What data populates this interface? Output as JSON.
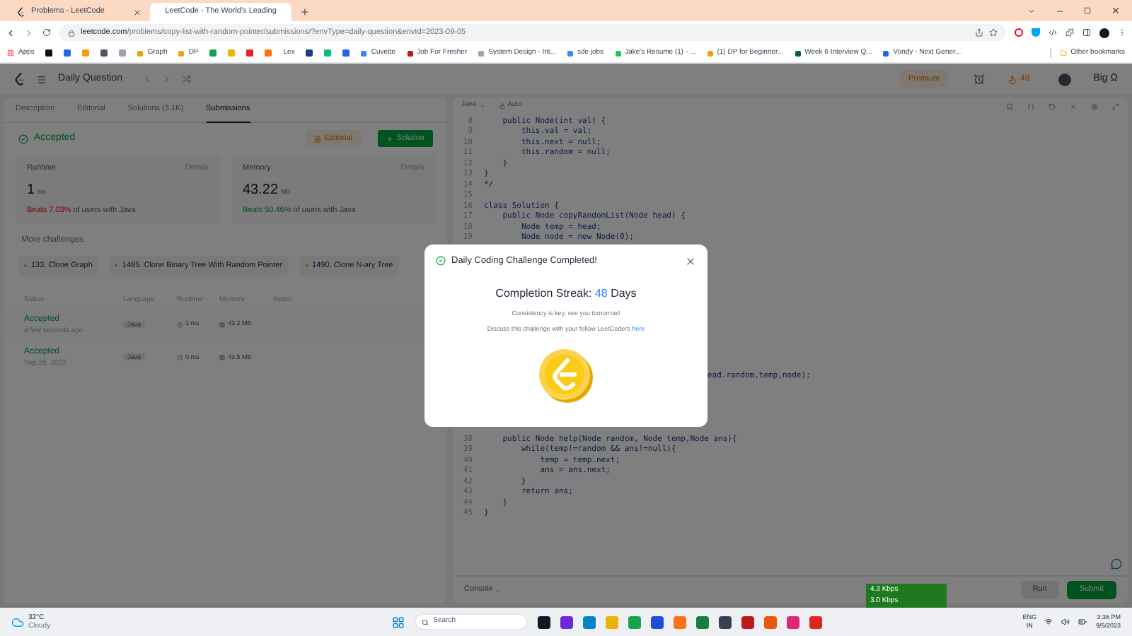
{
  "browser": {
    "tabs": [
      {
        "title": "Problems - LeetCode",
        "selected": false
      },
      {
        "title": "LeetCode - The World's Leading",
        "selected": true
      }
    ],
    "url_host": "leetcode.com",
    "url_path": "/problems/copy-list-with-random-pointer/submissions/?envType=daily-question&envId=2023-09-05",
    "bookmarks": [
      {
        "kind": "apps",
        "label": "Apps"
      },
      {
        "kind": "icon",
        "color": "#111111"
      },
      {
        "kind": "icon",
        "color": "#2563eb"
      },
      {
        "kind": "icon",
        "color": "#f59e0b"
      },
      {
        "kind": "icon",
        "color": "#4b5563"
      },
      {
        "kind": "icon",
        "color": "#9ca3af"
      },
      {
        "kind": "link",
        "label": "Graph",
        "color": "#f59e0b"
      },
      {
        "kind": "link",
        "label": "DP",
        "color": "#f59e0b"
      },
      {
        "kind": "icon",
        "color": "#16a34a"
      },
      {
        "kind": "icon",
        "color": "#eab308"
      },
      {
        "kind": "icon",
        "color": "#dc2626"
      },
      {
        "kind": "icon",
        "color": "#f97316"
      },
      {
        "kind": "link",
        "label": "Lex"
      },
      {
        "kind": "icon",
        "color": "#1e3a8a"
      },
      {
        "kind": "icon",
        "color": "#10b981"
      },
      {
        "kind": "icon",
        "color": "#2563eb"
      },
      {
        "kind": "link",
        "label": "Cuvette",
        "color": "#3b82f6"
      },
      {
        "kind": "link",
        "label": "Job For Fresher",
        "color": "#b91c1c"
      },
      {
        "kind": "link",
        "label": "System Design - Int...",
        "color": "#9ca3af"
      },
      {
        "kind": "link",
        "label": "sde jobs",
        "color": "#4285f4"
      },
      {
        "kind": "link",
        "label": "Jake's Resume (1) - ...",
        "color": "#22c55e"
      },
      {
        "kind": "link",
        "label": "(1) DP for Beginner...",
        "color": "#f59e0b"
      },
      {
        "kind": "link",
        "label": "Week 6 Interview Q...",
        "color": "#065f46"
      },
      {
        "kind": "link",
        "label": "Vondy - Next Gener...",
        "color": "#2563eb"
      }
    ],
    "other_bookmarks": "Other bookmarks"
  },
  "header": {
    "title": "Daily Question",
    "premium": "Premium",
    "streak": "48",
    "user": "Big Ω"
  },
  "problem_tabs": [
    {
      "label": "Description",
      "selected": false
    },
    {
      "label": "Editorial",
      "selected": false
    },
    {
      "label": "Solutions (3.1K)",
      "selected": false
    },
    {
      "label": "Submissions",
      "selected": true
    }
  ],
  "result": {
    "status": "Accepted",
    "editorial_button": "Editorial",
    "solution_button": "Solution"
  },
  "stats": [
    {
      "label": "Runtime",
      "details": "Details",
      "value": "1",
      "unit": "ms",
      "beats": "Beats 7.03%",
      "beats_rest": "of users with Java",
      "kind": "slow"
    },
    {
      "label": "Memory",
      "details": "Details",
      "value": "43.22",
      "unit": "MB",
      "beats": "Beats 50.46%",
      "beats_rest": "of users with Java",
      "kind": "fast"
    }
  ],
  "more_challenges": {
    "title": "More challenges",
    "items": [
      "133. Clone Graph",
      "1485. Clone Binary Tree With Random Pointer",
      "1490. Clone N-ary Tree"
    ]
  },
  "submissions": {
    "columns": [
      "Status",
      "Language",
      "Runtime",
      "Memory",
      "Notes"
    ],
    "rows": [
      {
        "status": "Accepted",
        "time": "a few seconds ago",
        "language": "Java",
        "runtime": "1 ms",
        "memory": "43.2 MB"
      },
      {
        "status": "Accepted",
        "time": "Sep 29, 2022",
        "language": "Java",
        "runtime": "0 ms",
        "memory": "43.5 MB"
      }
    ]
  },
  "editor": {
    "language": "Java",
    "mode": "Auto",
    "upper_lines": [
      {
        "number": "8",
        "text": "    public Node(int val) {"
      },
      {
        "number": "9",
        "text": "        this.val = val;"
      },
      {
        "number": "10",
        "text": "        this.next = null;"
      },
      {
        "number": "11",
        "text": "        this.random = null;"
      },
      {
        "number": "12",
        "text": "    }"
      },
      {
        "number": "13",
        "text": "}"
      },
      {
        "number": "14",
        "text": "*/"
      },
      {
        "number": "15"
      },
      {
        "number": "16",
        "text": "class Solution {"
      },
      {
        "number": "17",
        "text": "    public Node copyRandomList(Node head) {"
      },
      {
        "number": "18",
        "text": "        Node temp = head;"
      },
      {
        "number": "19",
        "text": "        Node node = new Node(0);"
      }
    ],
    "partial_line": "ead.random,temp,node);",
    "lower_lines": [
      {
        "number": "38",
        "text": "    public Node help(Node random, Node temp,Node ans){"
      },
      {
        "number": "39",
        "text": "        while(temp!=random && ans!=null){"
      },
      {
        "number": "40",
        "text": "            temp = temp.next;"
      },
      {
        "number": "41",
        "text": "            ans = ans.next;"
      },
      {
        "number": "42",
        "text": "        }"
      },
      {
        "number": "43",
        "text": "        return ans;"
      },
      {
        "number": "44",
        "text": "    }"
      },
      {
        "number": "45",
        "text": "}"
      }
    ],
    "console": "Console",
    "run": "Run",
    "submit": "Submit"
  },
  "net_speed": [
    "4.3 Kbps",
    "3.0 Kbps"
  ],
  "modal": {
    "open": true,
    "title": "Daily Coding Challenge Completed!",
    "streak_label": "Completion Streak:",
    "streak_value": "48",
    "streak_unit": "Days",
    "message": "Consistency is key, see you tomorrow!",
    "discuss": "Discuss this challenge with your fellow LeetCoders",
    "link": "here"
  },
  "taskbar": {
    "temperature": "32°C",
    "weather": "Cloudy",
    "search": "Search",
    "apps": [
      {
        "color": "#111827"
      },
      {
        "color": "#6d28d9"
      },
      {
        "color": "#0284c7"
      },
      {
        "color": "#eab308"
      },
      {
        "color": "#16a34a"
      },
      {
        "color": "#1d4ed8"
      },
      {
        "color": "#f97316"
      },
      {
        "color": "#15803d"
      },
      {
        "color": "#374151"
      },
      {
        "color": "#b91c1c"
      },
      {
        "color": "#ea580c"
      },
      {
        "color": "#db2777"
      },
      {
        "color": "#dc2626"
      }
    ],
    "language": "ENG",
    "region": "IN",
    "time": "3:36 PM",
    "date": "9/5/2023"
  }
}
